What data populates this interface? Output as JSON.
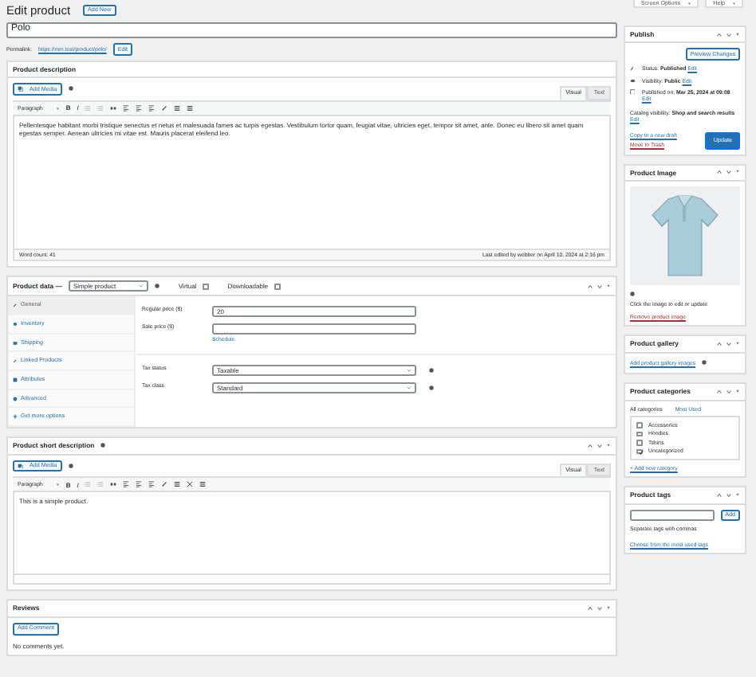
{
  "top_tabs": [
    {
      "label": "Screen Options"
    },
    {
      "label": "Help"
    }
  ],
  "page_title": "Edit product",
  "add_new": "Add New",
  "title_field": {
    "value": "Polo"
  },
  "permalink": {
    "label": "Permalink:",
    "url": "https://mm.test/product/polo/",
    "button": "Edit"
  },
  "description": {
    "title": "Product description",
    "add_media": "Add Media",
    "tabs": [
      {
        "label": "Visual",
        "selected": true
      },
      {
        "label": "Text",
        "selected": false
      }
    ],
    "format": "Paragraph",
    "toolbar": [
      "B",
      "I"
    ],
    "text": "Pellentesque habitant morbi tristique senectus et netus et malesuada fames ac turpis egestas. Vestibulum tortor quam, feugiat vitae, ultricies eget, tempor sit amet, ante. Donec eu libero sit amet quam egestas semper. Aenean ultricies mi vitae est. Mauris placerat eleifend leo.",
    "word_count": "Word count: 41",
    "last_edited": "Last edited by webber on April 10, 2024 at 2:16 pm"
  },
  "product_data": {
    "title": "Product data —",
    "type": "Simple product",
    "options": [
      {
        "label": "Virtual",
        "checked": false
      },
      {
        "label": "Downloadable",
        "checked": false
      }
    ],
    "tabs": [
      {
        "label": "General",
        "selected": true
      },
      {
        "label": "Inventory",
        "selected": false
      },
      {
        "label": "Shipping",
        "selected": false
      },
      {
        "label": "Linked Products",
        "selected": false
      },
      {
        "label": "Attributes",
        "selected": false
      },
      {
        "label": "Advanced",
        "selected": false
      },
      {
        "label": "Get more options",
        "selected": false
      }
    ],
    "fields": [
      {
        "kind": "input",
        "label": "Regular price ($)",
        "value": "20"
      },
      {
        "kind": "input",
        "label": "Sale price ($)",
        "link": "Schedule"
      },
      {
        "kind": "select",
        "label": "Tax status",
        "value": "Taxable"
      },
      {
        "kind": "select",
        "label": "Tax class",
        "value": "Standard"
      }
    ]
  },
  "short_description": {
    "title": "Product short description",
    "add_media": "Add Media",
    "tabs": [
      {
        "label": "Visual",
        "selected": true
      },
      {
        "label": "Text",
        "selected": false
      }
    ],
    "format": "Paragraph",
    "toolbar": [
      "B",
      "I"
    ],
    "text": "This is a simple product."
  },
  "reviews": {
    "title": "Reviews",
    "button": "Add Comment",
    "empty": "No comments yet."
  },
  "publish": {
    "title": "Publish",
    "preview": "Preview Changes",
    "rows": [
      {
        "label": "Status:",
        "value": "Published",
        "edit": "Edit"
      },
      {
        "label": "Visibility:",
        "value": "Public",
        "edit": "Edit"
      },
      {
        "label": "Published on:",
        "value": "Mar 25, 2024 at 09:08",
        "edit": "Edit"
      }
    ],
    "catalog": {
      "label": "Catalog visibility:",
      "value": "Shop and search results",
      "edit": "Edit"
    },
    "copy": "Copy to a new draft",
    "trash": "Move to Trash",
    "update": "Update"
  },
  "product_image": {
    "title": "Product Image",
    "hint": "Click the image to edit or update",
    "remove": "Remove product image"
  },
  "gallery": {
    "title": "Product gallery",
    "link": "Add product gallery images"
  },
  "categories": {
    "title": "Product categories",
    "tabs": [
      {
        "label": "All categories",
        "selected": true
      },
      {
        "label": "Most Used",
        "selected": false
      }
    ],
    "items": [
      {
        "label": "Accessories",
        "checked": false
      },
      {
        "label": "Hoodies",
        "checked": false
      },
      {
        "label": "Tshirts",
        "checked": false
      },
      {
        "label": "Uncategorized",
        "checked": true
      }
    ],
    "add": "+ Add new category"
  },
  "tags": {
    "title": "Product tags",
    "button": "Add",
    "hint": "Separate tags with commas",
    "link": "Choose from the most used tags"
  }
}
